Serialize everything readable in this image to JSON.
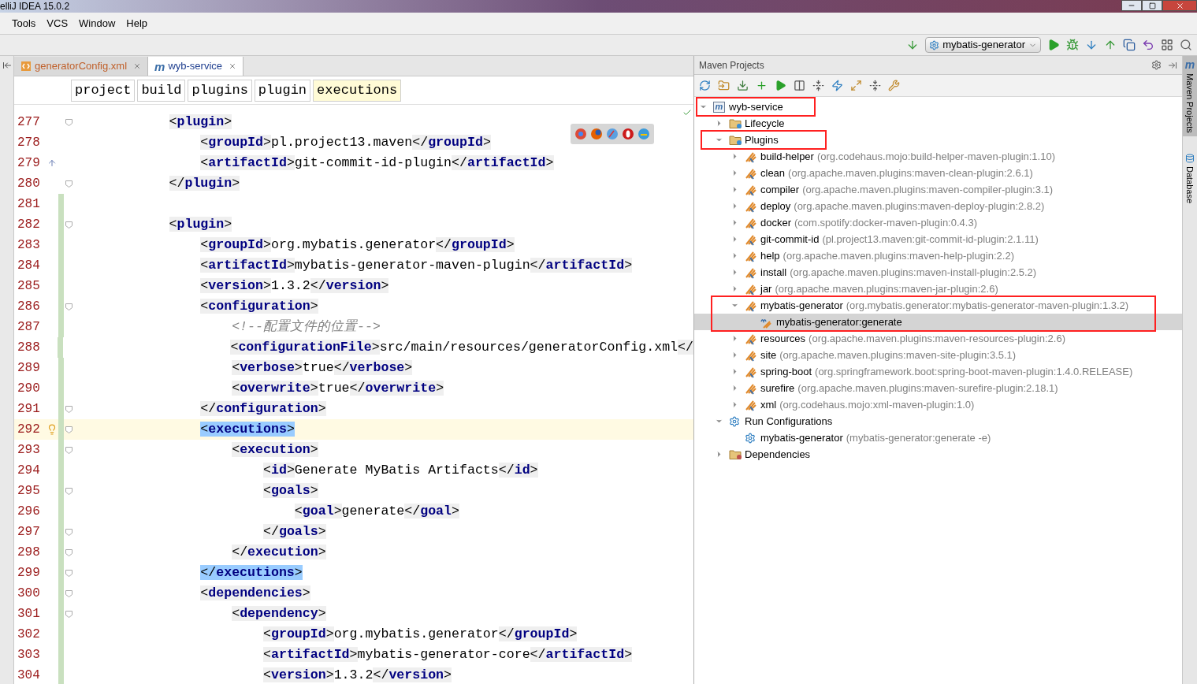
{
  "window": {
    "title": "elliJ IDEA 15.0.2"
  },
  "menu": [
    "Tools",
    "VCS",
    "Window",
    "Help"
  ],
  "toolbar": {
    "run_config": "mybatis-generator"
  },
  "editor": {
    "tabs": [
      {
        "label": "generatorConfig.xml",
        "kind": "xml",
        "selected": false
      },
      {
        "label": "wyb-service",
        "kind": "maven",
        "icon_text": "m",
        "selected": true
      }
    ],
    "breadcrumbs": [
      {
        "label": "project",
        "selected": false
      },
      {
        "label": "build",
        "selected": false
      },
      {
        "label": "plugins",
        "selected": false
      },
      {
        "label": "plugin",
        "selected": false
      },
      {
        "label": "executions",
        "selected": true
      }
    ],
    "lines": [
      {
        "number": "277",
        "kind": "code",
        "code": "            <plugin>",
        "fold": true,
        "changed": false,
        "current": false,
        "matched": false
      },
      {
        "number": "278",
        "kind": "code",
        "code": "                <groupId>pl.project13.maven</groupId>",
        "fold": false,
        "changed": false,
        "current": false,
        "matched": false
      },
      {
        "number": "279",
        "kind": "code",
        "code": "                <artifactId>git-commit-id-plugin</artifactId>",
        "fold": false,
        "changed": false,
        "current": false,
        "matched": false,
        "gutter": {
          "kind": "override"
        }
      },
      {
        "number": "280",
        "kind": "code",
        "code": "            </plugin>",
        "fold": true,
        "changed": false,
        "current": false,
        "matched": false
      },
      {
        "number": "281",
        "kind": "code",
        "fold": false,
        "changed": true,
        "current": false
      },
      {
        "number": "282",
        "kind": "code",
        "code": "            <plugin>",
        "fold": true,
        "changed": true,
        "current": false,
        "matched": false
      },
      {
        "number": "283",
        "kind": "code",
        "code": "                <groupId>org.mybatis.generator</groupId>",
        "fold": false,
        "changed": true,
        "current": false,
        "matched": false
      },
      {
        "number": "284",
        "kind": "code",
        "code": "                <artifactId>mybatis-generator-maven-plugin</artifactId>",
        "fold": false,
        "changed": true,
        "current": false,
        "matched": false
      },
      {
        "number": "285",
        "kind": "code",
        "code": "                <version>1.3.2</version>",
        "fold": false,
        "changed": true,
        "current": false,
        "matched": false
      },
      {
        "number": "286",
        "kind": "code",
        "code": "                <configuration>",
        "fold": true,
        "changed": true,
        "current": false,
        "matched": false
      },
      {
        "number": "287",
        "kind": "comment",
        "code": "                    <!--配置文件的位置-->",
        "fold": false,
        "changed": true,
        "current": false,
        "matched": false
      },
      {
        "number": "288",
        "kind": "code",
        "code": "                    <configurationFile>src/main/resources/generatorConfig.xml</",
        "fold": false,
        "changed": true,
        "current": false,
        "matched": false
      },
      {
        "number": "289",
        "kind": "code",
        "code": "                    <verbose>true</verbose>",
        "fold": false,
        "changed": true,
        "current": false,
        "matched": false
      },
      {
        "number": "290",
        "kind": "code",
        "code": "                    <overwrite>true</overwrite>",
        "fold": false,
        "changed": true,
        "current": false,
        "matched": false
      },
      {
        "number": "291",
        "kind": "code",
        "code": "                </configuration>",
        "fold": true,
        "changed": true,
        "current": false,
        "matched": false
      },
      {
        "number": "292",
        "kind": "code",
        "code": "                <executions>",
        "fold": true,
        "changed": true,
        "current": true,
        "matched": true,
        "gutter": {
          "kind": "bulb"
        }
      },
      {
        "number": "293",
        "kind": "code",
        "code": "                    <execution>",
        "fold": true,
        "changed": true,
        "current": false,
        "matched": false
      },
      {
        "number": "294",
        "kind": "code",
        "code": "                        <id>Generate MyBatis Artifacts</id>",
        "fold": false,
        "changed": true,
        "current": false,
        "matched": false
      },
      {
        "number": "295",
        "kind": "code",
        "code": "                        <goals>",
        "fold": true,
        "changed": true,
        "current": false,
        "matched": false
      },
      {
        "number": "296",
        "kind": "code",
        "code": "                            <goal>generate</goal>",
        "fold": false,
        "changed": true,
        "current": false,
        "matched": false
      },
      {
        "number": "297",
        "kind": "code",
        "code": "                        </goals>",
        "fold": true,
        "changed": true,
        "current": false,
        "matched": false
      },
      {
        "number": "298",
        "kind": "code",
        "code": "                    </execution>",
        "fold": true,
        "changed": true,
        "current": false,
        "matched": false
      },
      {
        "number": "299",
        "kind": "code",
        "code": "                </executions>",
        "fold": true,
        "changed": true,
        "current": false,
        "matched": true
      },
      {
        "number": "300",
        "kind": "code",
        "code": "                <dependencies>",
        "fold": true,
        "changed": true,
        "current": false,
        "matched": false
      },
      {
        "number": "301",
        "kind": "code",
        "code": "                    <dependency>",
        "fold": true,
        "changed": true,
        "current": false,
        "matched": false
      },
      {
        "number": "302",
        "kind": "code",
        "code": "                        <groupId>org.mybatis.generator</groupId>",
        "fold": false,
        "changed": true,
        "current": false,
        "matched": false
      },
      {
        "number": "303",
        "kind": "code",
        "code": "                        <artifactId>mybatis-generator-core</artifactId>",
        "fold": false,
        "changed": true,
        "current": false,
        "matched": false
      },
      {
        "number": "304",
        "kind": "code",
        "code": "                        <version>1.3.2</version>",
        "fold": false,
        "changed": true,
        "current": false,
        "matched": false
      }
    ]
  },
  "maven": {
    "title": "Maven Projects",
    "tree": [
      {
        "label": "wyb-service",
        "kind": "project",
        "icon_text": "m",
        "expanded": true,
        "selected": false,
        "annotated": true,
        "children": [
          {
            "label": "Lifecycle",
            "kind": "folder",
            "expanded": false,
            "selected": false,
            "annotated": false
          },
          {
            "label": "Plugins",
            "kind": "folder",
            "expanded": true,
            "selected": false,
            "annotated": true,
            "children": [
              {
                "label": "build-helper",
                "detail": "(org.codehaus.mojo:build-helper-maven-plugin:1.10)",
                "kind": "plugin",
                "expanded": false,
                "selected": false,
                "annotated": false
              },
              {
                "label": "clean",
                "detail": "(org.apache.maven.plugins:maven-clean-plugin:2.6.1)",
                "kind": "plugin",
                "expanded": false,
                "selected": false,
                "annotated": false
              },
              {
                "label": "compiler",
                "detail": "(org.apache.maven.plugins:maven-compiler-plugin:3.1)",
                "kind": "plugin",
                "expanded": false,
                "selected": false,
                "annotated": false
              },
              {
                "label": "deploy",
                "detail": "(org.apache.maven.plugins:maven-deploy-plugin:2.8.2)",
                "kind": "plugin",
                "expanded": false,
                "selected": false,
                "annotated": false
              },
              {
                "label": "docker",
                "detail": "(com.spotify:docker-maven-plugin:0.4.3)",
                "kind": "plugin",
                "expanded": false,
                "selected": false,
                "annotated": false
              },
              {
                "label": "git-commit-id",
                "detail": "(pl.project13.maven:git-commit-id-plugin:2.1.11)",
                "kind": "plugin",
                "expanded": false,
                "selected": false,
                "annotated": false
              },
              {
                "label": "help",
                "detail": "(org.apache.maven.plugins:maven-help-plugin:2.2)",
                "kind": "plugin",
                "expanded": false,
                "selected": false,
                "annotated": false
              },
              {
                "label": "install",
                "detail": "(org.apache.maven.plugins:maven-install-plugin:2.5.2)",
                "kind": "plugin",
                "expanded": false,
                "selected": false,
                "annotated": false
              },
              {
                "label": "jar",
                "detail": "(org.apache.maven.plugins:maven-jar-plugin:2.6)",
                "kind": "plugin",
                "expanded": false,
                "selected": false,
                "annotated": false
              },
              {
                "label": "mybatis-generator",
                "detail": "(org.mybatis.generator:mybatis-generator-maven-plugin:1.3.2)",
                "kind": "plugin",
                "expanded": true,
                "selected": false,
                "annotated": true,
                "children": [
                  {
                    "label": "mybatis-generator:generate",
                    "kind": "goal",
                    "selected": true,
                    "annotated": false
                  }
                ]
              },
              {
                "label": "resources",
                "detail": "(org.apache.maven.plugins:maven-resources-plugin:2.6)",
                "kind": "plugin",
                "expanded": false,
                "selected": false,
                "annotated": false
              },
              {
                "label": "site",
                "detail": "(org.apache.maven.plugins:maven-site-plugin:3.5.1)",
                "kind": "plugin",
                "expanded": false,
                "selected": false,
                "annotated": false
              },
              {
                "label": "spring-boot",
                "detail": "(org.springframework.boot:spring-boot-maven-plugin:1.4.0.RELEASE)",
                "kind": "plugin",
                "expanded": false,
                "selected": false,
                "annotated": false
              },
              {
                "label": "surefire",
                "detail": "(org.apache.maven.plugins:maven-surefire-plugin:2.18.1)",
                "kind": "plugin",
                "expanded": false,
                "selected": false,
                "annotated": false
              },
              {
                "label": "xml",
                "detail": "(org.codehaus.mojo:xml-maven-plugin:1.0)",
                "kind": "plugin",
                "expanded": false,
                "selected": false,
                "annotated": false
              }
            ]
          },
          {
            "label": "Run Configurations",
            "kind": "configs",
            "expanded": true,
            "selected": false,
            "annotated": false,
            "children": [
              {
                "label": "mybatis-generator",
                "detail": "(mybatis-generator:generate -e)",
                "kind": "config",
                "selected": false,
                "annotated": false
              }
            ]
          },
          {
            "label": "Dependencies",
            "kind": "deps",
            "expanded": false,
            "selected": false,
            "annotated": false
          }
        ]
      }
    ]
  },
  "side_tabs": [
    {
      "label": "Maven Projects",
      "icon_text": "m",
      "selected": true
    },
    {
      "label": "Database",
      "selected": false
    }
  ]
}
